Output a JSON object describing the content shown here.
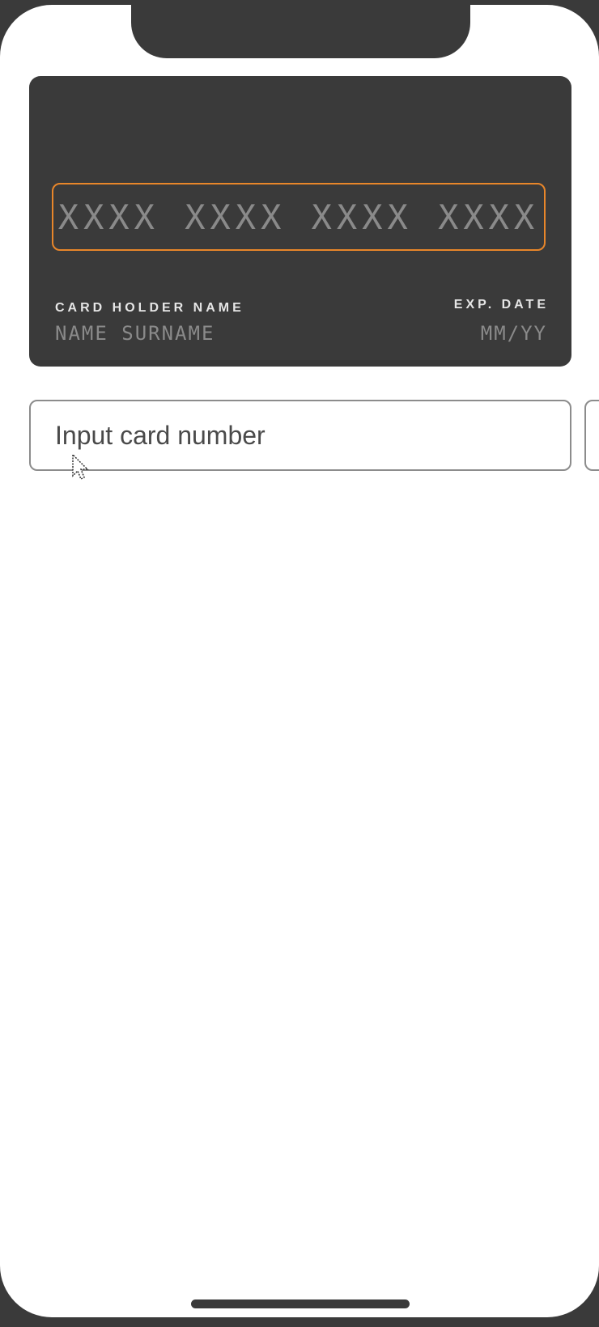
{
  "card": {
    "number_placeholder": "XXXX XXXX XXXX XXXX",
    "holder_label": "CARD HOLDER NAME",
    "holder_value": "NAME SURNAME",
    "exp_label": "EXP. DATE",
    "exp_value": "MM/YY"
  },
  "form": {
    "card_number_placeholder": "Input card number"
  },
  "colors": {
    "frame": "#3a3a3a",
    "card_background": "#3a3a3a",
    "focus_accent": "#e8862a",
    "placeholder_on_card": "#8a8a8a",
    "card_label": "#e6e6e6",
    "input_border": "#8c8c8c",
    "input_text": "#4a4a4a"
  },
  "icons": {
    "cursor": "mouse-pointer-icon"
  }
}
